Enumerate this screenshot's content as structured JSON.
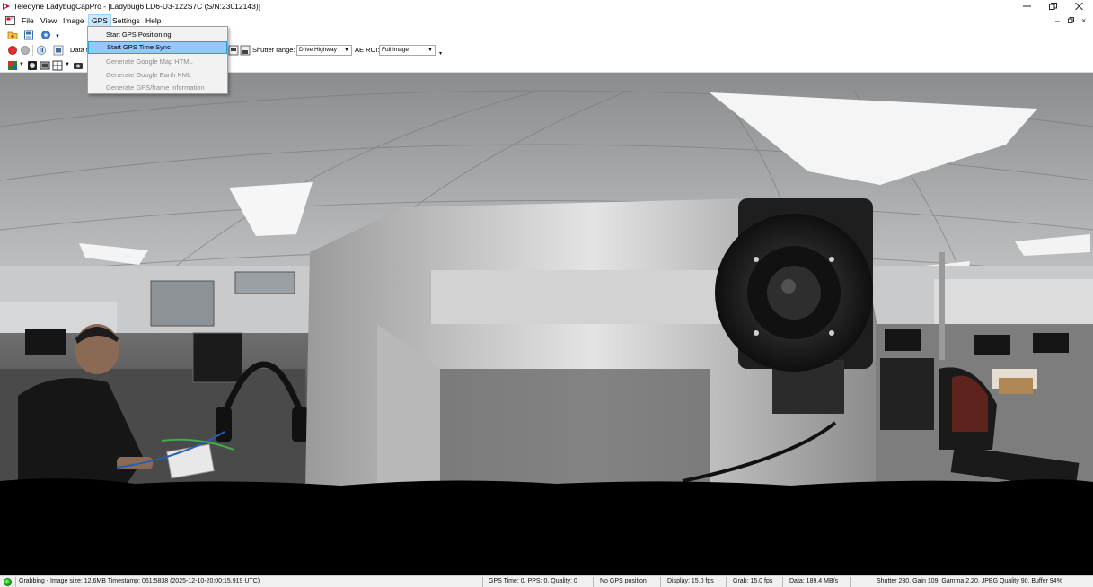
{
  "window": {
    "title": "Teledyne LadybugCapPro - [Ladybug6 LD6-U3-122S7C (S/N:23012143)]",
    "minimize_label": "–",
    "close_label": "✕"
  },
  "menu": {
    "items": [
      "File",
      "View",
      "Image",
      "GPS",
      "Settings",
      "Help"
    ],
    "active": "GPS"
  },
  "mdi": {
    "minimize": "–",
    "restore": "🗗",
    "close": "×"
  },
  "gps_menu": {
    "items": [
      {
        "label": "Start GPS Positioning",
        "enabled": true,
        "highlighted": false
      },
      {
        "label": "Start GPS Time Sync",
        "enabled": true,
        "highlighted": true
      },
      {
        "label": "Generate Google Map HTML",
        "enabled": false,
        "highlighted": false
      },
      {
        "label": "Generate Google Earth KML",
        "enabled": false,
        "highlighted": false
      },
      {
        "label": "Generate GPS/frame information",
        "enabled": false,
        "highlighted": false
      }
    ]
  },
  "toolbar": {
    "data_label": "Data f",
    "shutter_label": "Shutter range:",
    "shutter_value": "Drive Highway",
    "ae_roi_label": "AE ROI:",
    "ae_roi_value": "Full image"
  },
  "status": {
    "grabbing": "Grabbing - Image size: 12.6MB Timestamp: 061:5838 (2025-12-10-20:00:15.919 UTC)",
    "gps_time": "GPS Time: 0, PPS: 0, Quality: 0",
    "gps_position": "No GPS position",
    "display": "Display: 15.0 fps",
    "grab": "Grab: 15.0 fps",
    "data_rate": "Data: 189.4 MB/s",
    "camera": "Shutter 230, Gain 109, Gamma 2.20, JPEG Quality 90, Buffer 94%"
  },
  "colors": {
    "menu_highlight": "#91c9f7",
    "status_ok": "#0aa50a",
    "record_red": "#e03030"
  }
}
